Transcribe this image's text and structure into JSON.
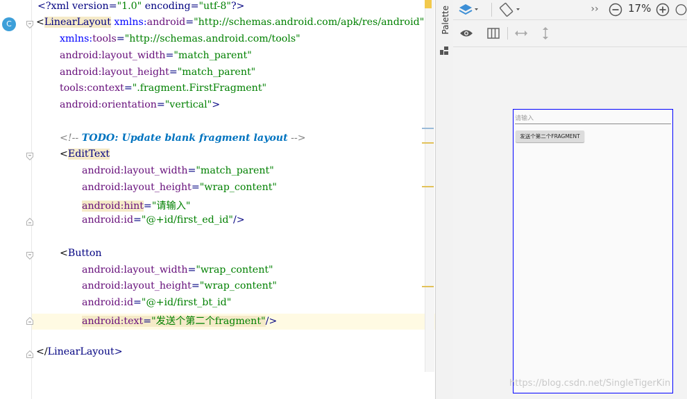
{
  "editor": {
    "gutter_badge": "C",
    "lines": {
      "l1": [
        "<?",
        "xml version=",
        "\"1.0\"",
        " encoding=",
        "\"utf-8\"",
        "?>"
      ],
      "l2": [
        "<",
        "LinearLayout",
        " ",
        "xmlns:",
        "android",
        "=",
        "\"http://schemas.android.com/apk/res/android\""
      ],
      "l3": [
        "xmlns:",
        "tools",
        "=",
        "\"http://schemas.android.com/tools\""
      ],
      "l4": [
        "android:",
        "layout_width",
        "=",
        "\"match_parent\""
      ],
      "l5": [
        "android:",
        "layout_height",
        "=",
        "\"match_parent\""
      ],
      "l6": [
        "tools:",
        "context",
        "=",
        "\".fragment.FirstFragment\""
      ],
      "l7": [
        "android:",
        "orientation",
        "=",
        "\"vertical\"",
        ">"
      ],
      "l8": [
        "<!-- ",
        "TODO: Update blank fragment layout",
        " -->"
      ],
      "l9": [
        "<",
        "EditText"
      ],
      "l10": [
        "android:",
        "layout_width",
        "=",
        "\"match_parent\""
      ],
      "l11": [
        "android:",
        "layout_height",
        "=",
        "\"wrap_content\""
      ],
      "l12": [
        "android:",
        "hint",
        "=",
        "\"请输入\""
      ],
      "l13": [
        "android:",
        "id",
        "=",
        "\"@+id/first_ed_id\"",
        "/>"
      ],
      "l14": [
        "<",
        "Button"
      ],
      "l15": [
        "android:",
        "layout_width",
        "=",
        "\"wrap_content\""
      ],
      "l16": [
        "android:",
        "layout_height",
        "=",
        "\"wrap_content\""
      ],
      "l17": [
        "android:",
        "id",
        "=",
        "\"@+id/first_bt_id\""
      ],
      "l18": [
        "android:",
        "text",
        "=",
        "\"发送个第二个fragment\"",
        "/>"
      ],
      "l19": [
        "</",
        "LinearLayout",
        ">"
      ]
    }
  },
  "palette": {
    "label": "Palette"
  },
  "design": {
    "zoom": "17%",
    "preview": {
      "edit_hint": "请输入",
      "button_text": "发送个第二个FRAGMENT"
    },
    "watermark": "https://blog.csdn.net/SingleTigerKin"
  },
  "colors": {
    "tag": "#000080",
    "attribute": "#660e7a",
    "value": "#008000",
    "namespace": "#0000ff",
    "comment": "#808080",
    "todo": "#0073bf",
    "blueprint": "#0000ff",
    "warning": "#f2c94c"
  }
}
